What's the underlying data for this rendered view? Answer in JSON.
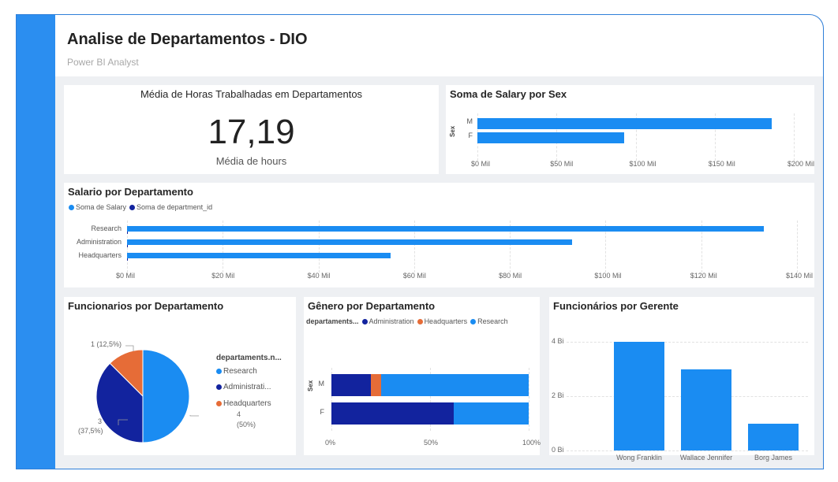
{
  "header": {
    "title": "Analise de Departamentos - DIO",
    "subtitle": "Power BI Analyst"
  },
  "colors": {
    "light_blue": "#1a8cf2",
    "dark_blue": "#12239e",
    "orange": "#e66c37",
    "sidebar": "#2b8ef0"
  },
  "kpi": {
    "title": "Média de Horas Trabalhadas em Departamentos",
    "value": "17,19",
    "label": "Média de hours"
  },
  "salary_sex": {
    "title": "Soma de Salary por Sex",
    "axis_title": "Sex",
    "ticks": [
      "$0 Mil",
      "$50 Mil",
      "$100 Mil",
      "$150 Mil",
      "$200 Mil"
    ]
  },
  "salary_dept": {
    "title": "Salario por Departamento",
    "legend": [
      "Soma de Salary",
      "Soma de department_id"
    ],
    "ticks": [
      "$0 Mil",
      "$20 Mil",
      "$40 Mil",
      "$60 Mil",
      "$80 Mil",
      "$100 Mil",
      "$120 Mil",
      "$140 Mil"
    ]
  },
  "pie": {
    "title": "Funcionarios por Departamento",
    "legend_title": "departaments.n...",
    "legend": [
      "Research",
      "Administrati...",
      "Headquarters"
    ],
    "labels": [
      "1 (12,5%)",
      "3",
      "(37,5%)",
      "4",
      "(50%)"
    ]
  },
  "genero": {
    "title": "Gênero por Departamento",
    "legend_title": "departaments...",
    "legend": [
      "Administration",
      "Headquarters",
      "Research"
    ],
    "axis_title": "Sex",
    "ticks": [
      "0%",
      "50%",
      "100%"
    ]
  },
  "gerente": {
    "title": "Funcionários por Gerente",
    "ticks": [
      "4 Bi",
      "2 Bi",
      "0 Bi"
    ]
  },
  "chart_data": [
    {
      "type": "bar",
      "title": "Soma de Salary por Sex",
      "ylabel": "Sex",
      "categories": [
        "M",
        "F"
      ],
      "values": [
        186000,
        93000
      ],
      "xlim": [
        0,
        200000
      ]
    },
    {
      "type": "bar",
      "title": "Salario por Departamento",
      "categories": [
        "Research",
        "Administration",
        "Headquarters"
      ],
      "series": [
        {
          "name": "Soma de Salary",
          "values": [
            133000,
            93000,
            55000
          ]
        },
        {
          "name": "Soma de department_id",
          "values": [
            0,
            0,
            0
          ]
        }
      ],
      "xlim": [
        0,
        140000
      ]
    },
    {
      "type": "pie",
      "title": "Funcionarios por Departamento",
      "categories": [
        "Research",
        "Administration",
        "Headquarters"
      ],
      "values": [
        4,
        3,
        1
      ]
    },
    {
      "type": "bar",
      "title": "Gênero por Departamento",
      "ylabel": "Sex",
      "categories": [
        "M",
        "F"
      ],
      "series": [
        {
          "name": "Administration",
          "values": [
            0.2,
            0.62
          ]
        },
        {
          "name": "Headquarters",
          "values": [
            0.05,
            0
          ]
        },
        {
          "name": "Research",
          "values": [
            0.75,
            0.38
          ]
        }
      ],
      "xlim": [
        0,
        1
      ]
    },
    {
      "type": "bar",
      "title": "Funcionários por Gerente",
      "categories": [
        "Wong Franklin",
        "Wallace Jennifer",
        "Borg James"
      ],
      "values": [
        4,
        3,
        1
      ],
      "ylim": [
        0,
        4.5
      ]
    }
  ]
}
